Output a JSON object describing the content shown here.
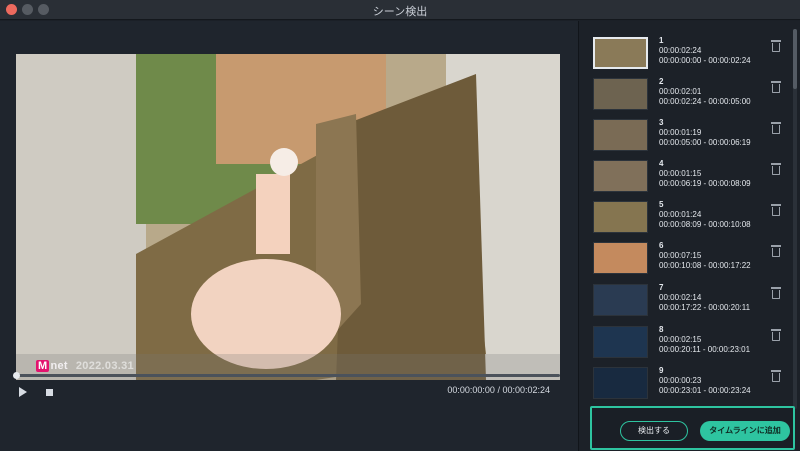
{
  "window": {
    "title": "シーン検出"
  },
  "player": {
    "watermark_brand": "M",
    "watermark_brand_rest": "net",
    "watermark_date": "2022.03.31",
    "current_time": "00:00:00:00",
    "separator": " / ",
    "total_time": "00:00:02:24",
    "progress": 0
  },
  "scenes": [
    {
      "number": "1",
      "duration": "00:00:02:24",
      "range": "00:00:00:00 - 00:00:02:24",
      "thumb_color": "#8a7a58",
      "selected": true
    },
    {
      "number": "2",
      "duration": "00:00:02:01",
      "range": "00:00:02:24 - 00:00:05:00",
      "thumb_color": "#6d6350"
    },
    {
      "number": "3",
      "duration": "00:00:01:19",
      "range": "00:00:05:00 - 00:00:06:19",
      "thumb_color": "#7a6b55"
    },
    {
      "number": "4",
      "duration": "00:00:01:15",
      "range": "00:00:06:19 - 00:00:08:09",
      "thumb_color": "#80705a"
    },
    {
      "number": "5",
      "duration": "00:00:01:24",
      "range": "00:00:08:09 - 00:00:10:08",
      "thumb_color": "#857550"
    },
    {
      "number": "6",
      "duration": "00:00:07:15",
      "range": "00:00:10:08 - 00:00:17:22",
      "thumb_color": "#c48a5e"
    },
    {
      "number": "7",
      "duration": "00:00:02:14",
      "range": "00:00:17:22 - 00:00:20:11",
      "thumb_color": "#2a3b52"
    },
    {
      "number": "8",
      "duration": "00:00:02:15",
      "range": "00:00:20:11 - 00:00:23:01",
      "thumb_color": "#1e3550"
    },
    {
      "number": "9",
      "duration": "00:00:00:23",
      "range": "00:00:23:01 - 00:00:23:24",
      "thumb_color": "#182a40"
    }
  ],
  "actions": {
    "detect_label": "検出する",
    "add_label": "タイムラインに追加"
  },
  "colors": {
    "accent": "#2ec4a0",
    "background": "#1b2027"
  },
  "icons": {
    "play": "play-icon",
    "stop": "stop-icon",
    "trash": "trash-icon"
  }
}
